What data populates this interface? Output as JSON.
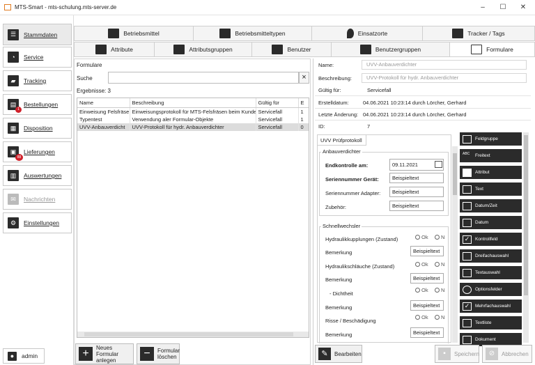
{
  "window": {
    "title": "MTS-Smart - mts-schulung.mts-server.de",
    "minimize": "–",
    "maximize": "☐",
    "close": "✕"
  },
  "sidebar": {
    "items": [
      {
        "label": "Stammdaten"
      },
      {
        "label": "Service"
      },
      {
        "label": "Tracking"
      },
      {
        "label": "Bestellungen",
        "badge": "1"
      },
      {
        "label": "Disposition"
      },
      {
        "label": "Lieferungen",
        "badge": "88"
      },
      {
        "label": "Auswertungen"
      },
      {
        "label": "Nachrichten"
      },
      {
        "label": "Einstellungen"
      }
    ],
    "user": "admin"
  },
  "tabs_row1": [
    "Betriebsmittel",
    "Betriebsmitteltypen",
    "Einsatzorte",
    "Tracker / Tags"
  ],
  "tabs_row2": [
    "Attribute",
    "Attributsgruppen",
    "Benutzer",
    "Benutzergruppen",
    "Formulare"
  ],
  "list": {
    "heading": "Formulare",
    "search_label": "Suche",
    "search_value": "",
    "clear": "×",
    "results_label": "Ergebnisse:",
    "results_count": "3",
    "columns": [
      "Name",
      "Beschreibung",
      "Gültig für",
      "E"
    ],
    "rows": [
      {
        "name": "Einweisung Felsfräse",
        "desc": "Einweisungsprotokoll für MTS-Felsfräsen beim Kunden",
        "valid": "Servicefall",
        "e": "1"
      },
      {
        "name": "Typentest",
        "desc": "Verwendung aler Formular-Objekte",
        "valid": "Servicefall",
        "e": "1"
      },
      {
        "name": "UVV-Anbauverdicht",
        "desc": "UVV-Protokoll für hydr. Anbauverdichter",
        "valid": "Servicefall",
        "e": "0"
      }
    ],
    "btn_new": [
      "Neues Formular",
      "anlegen"
    ],
    "btn_delete": [
      "Formular",
      "löschen"
    ]
  },
  "details": {
    "name_label": "Name:",
    "name_value": "UVV-Anbauverdichter",
    "desc_label": "Beschreibung:",
    "desc_value": "UVV-Protokoll für hydr. Anbauverdichter",
    "valid_label": "Gültig für:",
    "valid_value": "Servicefall",
    "created_label": "Erstelldatum:",
    "created_value": "04.06.2021 10:23:14 durch Lörcher, Gerhard",
    "changed_label": "Letzte Änderung:",
    "changed_value": "04.06.2021 10:23:14 durch Lörcher, Gerhard",
    "id_label": "ID:",
    "id_value": "7"
  },
  "form": {
    "tab": "UVV Prüfprotokoll",
    "group1": "Anbauverdichter",
    "endkontrolle_label": "Endkontrolle am:",
    "endkontrolle_value": "09.11.2021",
    "sn_geraet_label": "Seriennummer Gerät:",
    "sn_geraet_value": "Beispieltext",
    "sn_adapter_label": "Seriennummer Adapter:",
    "sn_adapter_value": "Beispieltext",
    "zubehoer_label": "Zubehör:",
    "zubehoer_value": "Beispieltext",
    "group2": "Schnellwechsler",
    "rows": [
      {
        "label": "Hydraulikkupplungen (Zustand)",
        "type": "radio"
      },
      {
        "label": "Bemerkung",
        "type": "text",
        "value": "Beispieltext"
      },
      {
        "label": "Hydraulikschläuche (Zustand)",
        "type": "radio"
      },
      {
        "label": "Bemerkung",
        "type": "text",
        "value": "Beispieltext"
      },
      {
        "label": "- Dichtheit",
        "type": "radio"
      },
      {
        "label": "Bemerkung",
        "type": "text",
        "value": "Beispieltext"
      },
      {
        "label": "Risse / Beschädigung",
        "type": "radio"
      },
      {
        "label": "Bemerkung",
        "type": "text",
        "value": "Beispieltext"
      }
    ],
    "radio_ok": "Ok",
    "radio_n": "N"
  },
  "palette": [
    "Feldgruppe",
    "Freitext",
    "Attribut",
    "Text",
    "Datum/Zeit",
    "Datum",
    "Kontrollfeld",
    "Dreifachauswahl",
    "Textauswahl",
    "Optionsfelder",
    "Mehrfachauswahl",
    "Textliste",
    "Dokument"
  ],
  "footer": {
    "edit": "Bearbeiten",
    "save": "Speichern",
    "cancel": "Abbrechen"
  }
}
